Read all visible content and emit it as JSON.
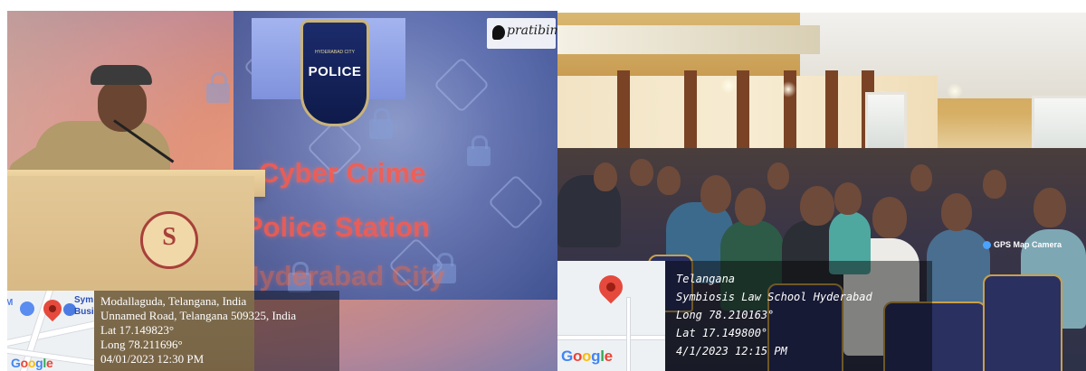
{
  "left_photo": {
    "screen_lines": [
      "Cyber Crime",
      "Police Station",
      "Hyderabad City"
    ],
    "badge_text": "POLICE",
    "badge_subtitle": "HYDERABAD CITY",
    "watermark": "pratibimb",
    "gps": {
      "map_label_fragment": "M",
      "map_business_fragment": [
        "Sym",
        "Busi"
      ],
      "google_logo": "Google",
      "lines": [
        "Modallaguda, Telangana, India",
        "Unnamed Road, Telangana 509325, India",
        "Lat 17.149823°",
        "Long 78.211696°",
        "04/01/2023 12:30 PM"
      ]
    }
  },
  "right_photo": {
    "gps_camera_label": "GPS Map Camera",
    "gps": {
      "google_logo": "Google",
      "lines": [
        "Telangana",
        "Symbiosis Law School Hyderabad",
        "Long 78.210163°",
        "Lat 17.149800°",
        "4/1/2023 12:15 PM"
      ]
    }
  },
  "colors": {
    "screen_text": "#ff5a4a",
    "map_pin": "#e54a3c",
    "overlay_text": "#ffffff"
  }
}
